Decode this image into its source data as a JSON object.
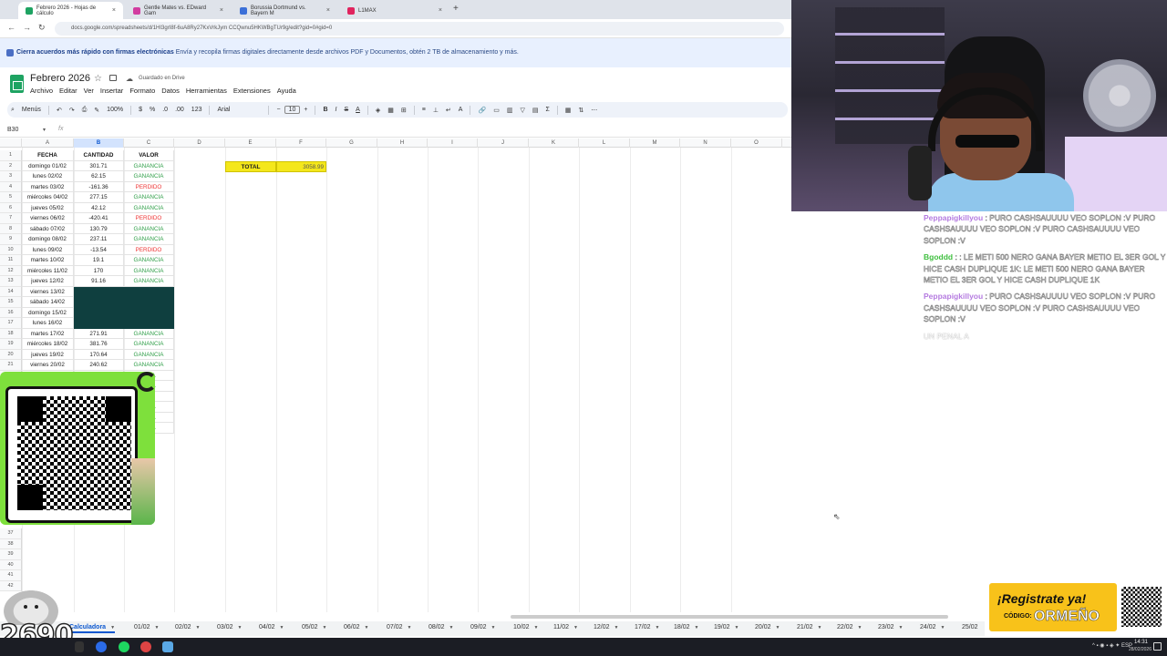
{
  "browser": {
    "tabs": [
      {
        "label": "Febrero 2026 - Hojas de cálculo",
        "color": "#1ea362",
        "active": true
      },
      {
        "label": "Gentle Mates vs. EDward Gam",
        "color": "#d23ca0",
        "active": false
      },
      {
        "label": "Borussia Dortmund vs. Bayern M",
        "color": "#3b6fd8",
        "active": false
      },
      {
        "label": "L1MAX",
        "color": "#e0245e",
        "active": false
      }
    ],
    "new_tab_symbol": "+",
    "url": "docs.google.com/spreadsheets/d/1HI3grI8f-6uA8Ry27KxVrkJym CCQwnu5HKWBgTUr9g/edit?gid=0#gid=0"
  },
  "banner": {
    "bold_text": "Cierra acuerdos más rápido con firmas electrónicas",
    "text": " Envía y recopila firmas digitales directamente desde archivos PDF y Documentos, obtén 2 TB de almacenamiento y más."
  },
  "doc": {
    "title": "Febrero 2026",
    "status": "Guardado en Drive",
    "menu": [
      "Archivo",
      "Editar",
      "Ver",
      "Insertar",
      "Formato",
      "Datos",
      "Herramientas",
      "Extensiones",
      "Ayuda"
    ]
  },
  "toolbar": {
    "menus_label": "Menús",
    "zoom": "100%",
    "currency": "$",
    "percent": "%",
    "dec_decrease": ".0",
    "dec_increase": ".00",
    "number_format": "123",
    "font": "Arial",
    "font_size": "10"
  },
  "formula_bar": {
    "name_box": "B30",
    "fx": "fx"
  },
  "sheet": {
    "columns": [
      "A",
      "B",
      "C",
      "D",
      "E",
      "F",
      "G",
      "H",
      "I",
      "J",
      "K",
      "L",
      "M",
      "N",
      "O"
    ],
    "selected_column": "B",
    "headers": {
      "a": "FECHA",
      "b": "CANTIDAD",
      "c": "VALOR"
    },
    "rows": [
      {
        "a": "domingo 01/02",
        "b": "301.71",
        "c": "GANANCIA"
      },
      {
        "a": "lunes 02/02",
        "b": "62.15",
        "c": "GANANCIA"
      },
      {
        "a": "martes 03/02",
        "b": "-161.36",
        "c": "PERDIDO"
      },
      {
        "a": "miércoles 04/02",
        "b": "277.15",
        "c": "GANANCIA"
      },
      {
        "a": "jueves 05/02",
        "b": "42.12",
        "c": "GANANCIA"
      },
      {
        "a": "viernes 06/02",
        "b": "-420.41",
        "c": "PERDIDO"
      },
      {
        "a": "sábado 07/02",
        "b": "130.79",
        "c": "GANANCIA"
      },
      {
        "a": "domingo 08/02",
        "b": "237.11",
        "c": "GANANCIA"
      },
      {
        "a": "lunes 09/02",
        "b": "-13.54",
        "c": "PERDIDO"
      },
      {
        "a": "martes 10/02",
        "b": "19.1",
        "c": "GANANCIA"
      },
      {
        "a": "miércoles 11/02",
        "b": "170",
        "c": "GANANCIA"
      },
      {
        "a": "jueves 12/02",
        "b": "91.16",
        "c": "GANANCIA"
      },
      {
        "a": "viernes 13/02",
        "b": "",
        "c": "",
        "dark": true
      },
      {
        "a": "sábado 14/02",
        "b": "",
        "c": "",
        "dark": true
      },
      {
        "a": "domingo 15/02",
        "b": "",
        "c": "",
        "dark": true
      },
      {
        "a": "lunes 16/02",
        "b": "",
        "c": "",
        "dark": true
      },
      {
        "a": "martes 17/02",
        "b": "271.91",
        "c": "GANANCIA"
      },
      {
        "a": "miércoles 18/02",
        "b": "381.76",
        "c": "GANANCIA"
      },
      {
        "a": "jueves 19/02",
        "b": "170.64",
        "c": "GANANCIA"
      },
      {
        "a": "viernes 20/02",
        "b": "240.62",
        "c": "GANANCIA"
      },
      {
        "a": "",
        "b": "",
        "c": "NCIA"
      },
      {
        "a": "",
        "b": "",
        "c": "NCIA"
      },
      {
        "a": "",
        "b": "",
        "c": "DO"
      },
      {
        "a": "",
        "b": "",
        "c": "NCIA"
      },
      {
        "a": "",
        "b": "",
        "c": "NCIA"
      },
      {
        "a": "",
        "b": "",
        "c": "NCIA"
      }
    ],
    "row_numbers_tail": [
      "37",
      "38",
      "39",
      "40",
      "41",
      "42"
    ],
    "total": {
      "label": "TOTAL",
      "value": "3058.99"
    }
  },
  "sheet_tabs": [
    "Calculadora",
    "01/02",
    "02/02",
    "03/02",
    "04/02",
    "05/02",
    "06/02",
    "07/02",
    "08/02",
    "09/02",
    "10/02",
    "11/02",
    "12/02",
    "17/02",
    "18/02",
    "19/02",
    "20/02",
    "21/02",
    "22/02",
    "23/02",
    "24/02",
    "25/02"
  ],
  "active_sheet_tab": "Calculadora",
  "chat": [
    {
      "user": "Peppapigkillyou",
      "user_color": "#b57be0",
      "text": "PURO CASHSAUUUU VEO SOPLON :V PURO CASHSAUUUU VEO SOPLON :V PURO CASHSAUUUU VEO SOPLON :V"
    },
    {
      "user": "Bgoddd",
      "user_color": "#3fbf3f",
      "text": ": LE METI 500 NERO GANA BAYER METIO EL 3ER GOL Y HICE CASH DUPLIQUE 1K: LE METI 500 NERO GANA BAYER METIO EL 3ER GOL Y HICE CASH DUPLIQUE 1K"
    },
    {
      "user": "Peppapigkillyou",
      "user_color": "#b57be0",
      "text": "PURO CASHSAUUUU VEO SOPLON :V PURO CASHSAUUUU VEO SOPLON :V PURO CASHSAUUUU VEO SOPLON :V"
    }
  ],
  "chat_partial": "UN PENAL A",
  "overlay": {
    "counter": "2690",
    "register_title": "¡Registrate ya!",
    "register_code_label": "CÓDIGO:",
    "register_code": "ORMEÑO"
  },
  "taskbar": {
    "time": "14:31",
    "date": "28/02/2026",
    "lang": "ESP"
  }
}
